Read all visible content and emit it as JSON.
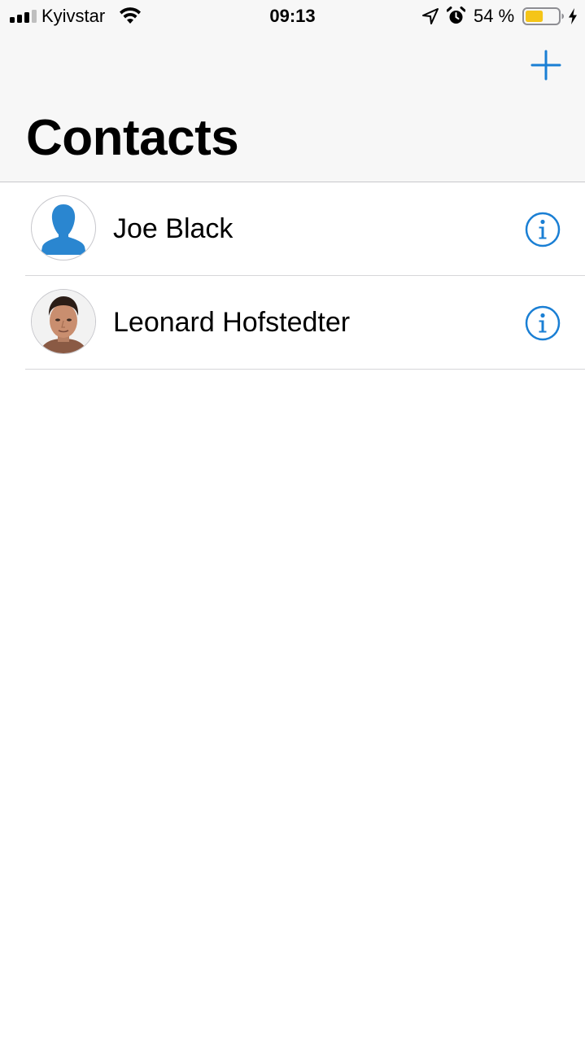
{
  "status_bar": {
    "carrier": "Kyivstar",
    "time": "09:13",
    "battery_percent": "54 %",
    "battery_level": 0.54,
    "icons": [
      "signal-icon",
      "wifi-icon",
      "location-icon",
      "alarm-icon",
      "battery-icon",
      "charging-icon"
    ]
  },
  "nav": {
    "add_icon": "plus-icon"
  },
  "page": {
    "title": "Contacts"
  },
  "contacts": [
    {
      "name": "Joe Black",
      "avatar": "placeholder-silhouette",
      "info_icon": "info-icon"
    },
    {
      "name": "Leonard Hofstedter",
      "avatar": "photo",
      "info_icon": "info-icon"
    }
  ],
  "colors": {
    "accent": "#1a7fd4",
    "header_bg": "#f7f7f7",
    "battery_fill": "#f5c518",
    "separator": "#d6d6d9"
  }
}
